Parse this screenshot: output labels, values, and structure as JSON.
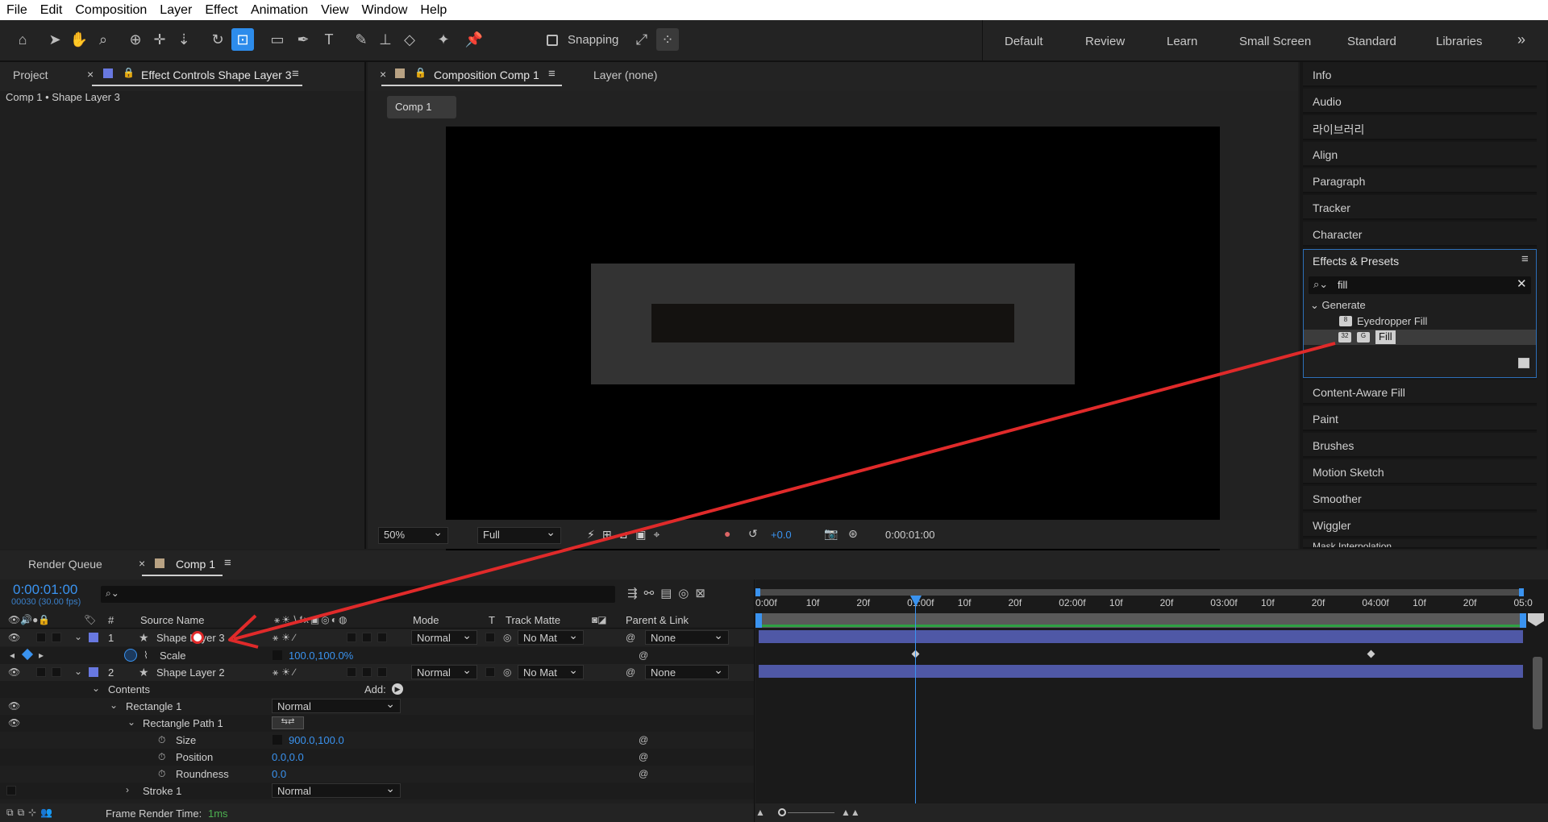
{
  "menu": [
    "File",
    "Edit",
    "Composition",
    "Layer",
    "Effect",
    "Animation",
    "View",
    "Window",
    "Help"
  ],
  "toolbar": {
    "snapping_label": "Snapping",
    "workspaces": [
      "Default",
      "Review",
      "Learn",
      "Small Screen",
      "Standard",
      "Libraries"
    ],
    "more": "»"
  },
  "left_panel": {
    "tab_project": "Project",
    "tab_effect_controls": "Effect Controls Shape Layer 3",
    "breadcrumb": "Comp 1 • Shape Layer 3"
  },
  "comp_panel": {
    "tab_comp": "Composition Comp 1",
    "tab_layer": "Layer (none)",
    "comp_chip": "Comp 1",
    "zoom": "50%",
    "resolution": "Full",
    "exposure": "+0.0",
    "timecode": "0:00:01:00"
  },
  "right_panel": {
    "items_top": [
      "Info",
      "Audio",
      "라이브러리",
      "Align",
      "Paragraph",
      "Tracker",
      "Character"
    ],
    "effects_title": "Effects & Presets",
    "search_value": "fill",
    "group": "Generate",
    "effect_items": [
      "Eyedropper Fill",
      "Fill"
    ],
    "items_bottom": [
      "Content-Aware Fill",
      "Paint",
      "Brushes",
      "Motion Sketch",
      "Smoother",
      "Wiggler",
      "Mask Interpolation"
    ]
  },
  "timeline": {
    "tab_render": "Render Queue",
    "tab_comp": "Comp 1",
    "timecode": "0:00:01:00",
    "fps": "00030 (30.00 fps)",
    "headers": {
      "num": "#",
      "source": "Source Name",
      "mode": "Mode",
      "t": "T",
      "track": "Track Matte",
      "parent": "Parent & Link"
    },
    "ruler": [
      "0:00f",
      "10f",
      "20f",
      "01:00f",
      "10f",
      "20f",
      "02:00f",
      "10f",
      "20f",
      "03:00f",
      "10f",
      "20f",
      "04:00f",
      "10f",
      "20f",
      "05:0"
    ],
    "layer1": {
      "num": "1",
      "name": "Shape Layer 3",
      "mode": "Normal",
      "matte": "No Mat",
      "parent": "None"
    },
    "scale": {
      "label": "Scale",
      "value": "100.0,100.0%"
    },
    "layer2": {
      "num": "2",
      "name": "Shape Layer 2",
      "mode": "Normal",
      "matte": "No Mat",
      "parent": "None"
    },
    "contents": "Contents",
    "add": "Add:",
    "rect1": {
      "label": "Rectangle 1",
      "mode": "Normal"
    },
    "rectpath": "Rectangle Path 1",
    "size": {
      "label": "Size",
      "value": "900.0,100.0"
    },
    "position": {
      "label": "Position",
      "value": "0.0,0.0"
    },
    "roundness": {
      "label": "Roundness",
      "value": "0.0"
    },
    "stroke": {
      "label": "Stroke 1",
      "mode": "Normal"
    },
    "frame_render_label": "Frame Render Time:",
    "frame_render_value": "1ms"
  },
  "colors": {
    "accent": "#2d8ceb",
    "layer_label": "#6878e0",
    "bar": "#4f58a6",
    "arrow": "#e02a2a"
  }
}
